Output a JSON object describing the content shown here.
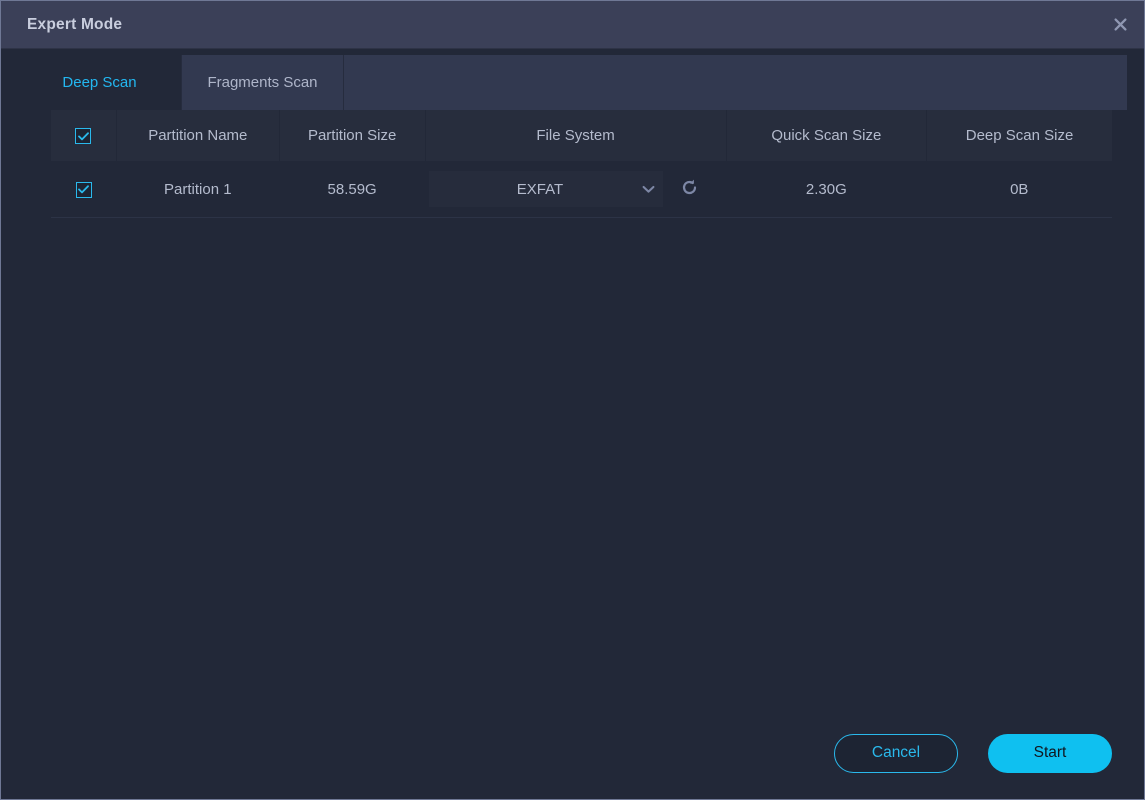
{
  "window": {
    "title": "Expert Mode",
    "close_icon": "close-icon"
  },
  "tabs": [
    {
      "label": "Deep Scan",
      "active": true
    },
    {
      "label": "Fragments Scan",
      "active": false
    }
  ],
  "table": {
    "headers": {
      "select_all": "",
      "partition_name": "Partition Name",
      "partition_size": "Partition Size",
      "file_system": "File System",
      "quick_scan_size": "Quick Scan Size",
      "deep_scan_size": "Deep Scan Size"
    },
    "rows": [
      {
        "checked": true,
        "partition_name": "Partition 1",
        "partition_size": "58.59G",
        "file_system": "EXFAT",
        "quick_scan_size": "2.30G",
        "deep_scan_size": "0B",
        "refresh_icon": "refresh-icon",
        "caret_icon": "chevron-down-icon"
      }
    ],
    "select_all_checked": true
  },
  "footer": {
    "cancel_label": "Cancel",
    "start_label": "Start"
  },
  "colors": {
    "accent": "#0fc0f0",
    "accent_outline": "#2ab9ec",
    "titlebar": "#3b4058",
    "body": "#222838",
    "tab_inactive": "#323950",
    "header_cell": "#272d3d",
    "text": "#b4bbcd"
  }
}
